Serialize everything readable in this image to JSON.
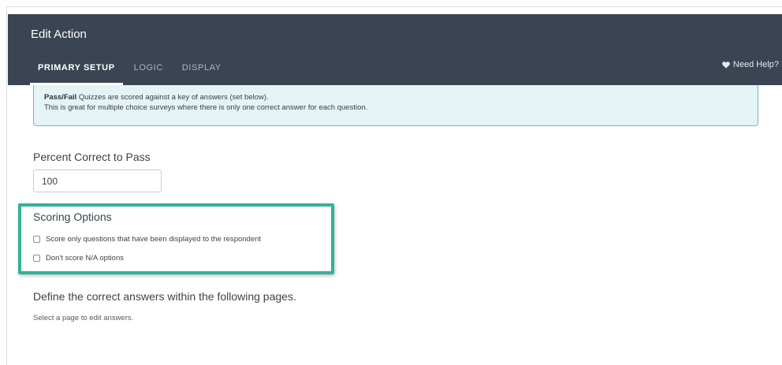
{
  "header": {
    "title": "Edit Action",
    "tabs": [
      {
        "label": "PRIMARY SETUP",
        "active": true
      },
      {
        "label": "LOGIC",
        "active": false
      },
      {
        "label": "DISPLAY",
        "active": false
      }
    ],
    "help_label": "Need Help?",
    "help_icon": "heart-icon",
    "background_color": "#3a4453"
  },
  "info": {
    "bold_prefix": "Pass/Fail",
    "line1_rest": " Quizzes are scored against a key of answers (set below).",
    "line2": "This is great for multiple choice surveys where there is only one correct answer for each question."
  },
  "percent_pass": {
    "label": "Percent Correct to Pass",
    "value": "100"
  },
  "scoring": {
    "label": "Scoring Options",
    "options": [
      {
        "label": "Score only questions that have been displayed to the respondent",
        "checked": false
      },
      {
        "label": "Don't score N/A options",
        "checked": false
      }
    ],
    "highlight_color": "#2fb29a"
  },
  "answers": {
    "heading": "Define the correct answers within the following pages.",
    "hint": "Select a page to edit answers."
  }
}
